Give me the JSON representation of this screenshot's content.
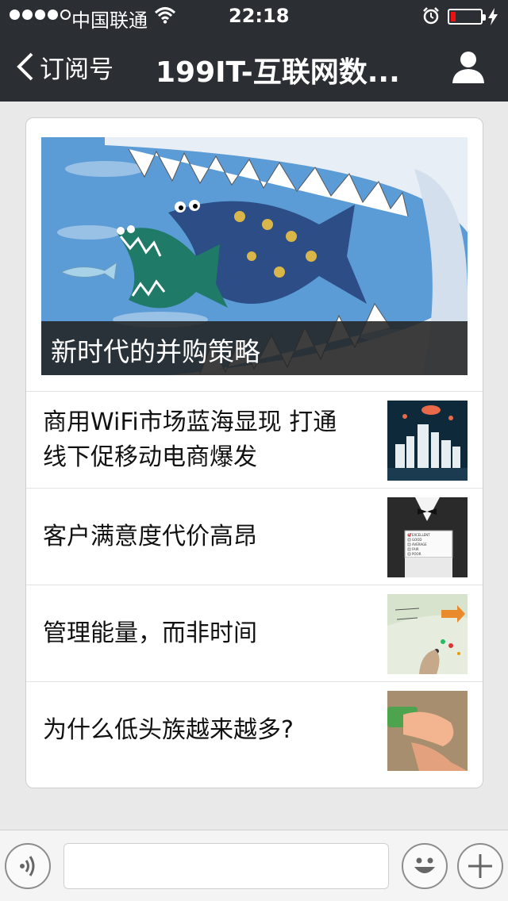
{
  "status_bar": {
    "carrier": "中国联通",
    "time": "22:18",
    "battery_color": "#e11111"
  },
  "nav": {
    "back_label": "订阅号",
    "title": "199IT-互联网数..."
  },
  "hero": {
    "caption": "新时代的并购策略"
  },
  "articles": [
    {
      "title": "商用WiFi市场蓝海显现 打通线下促移动电商爆发"
    },
    {
      "title": "客户满意度代价高昂",
      "thumb_text": [
        "EXCELLENT",
        "GOOD",
        "AVERAGE",
        "FAIR",
        "POOR"
      ]
    },
    {
      "title": "管理能量，而非时间"
    },
    {
      "title": "为什么低头族越来越多?"
    }
  ],
  "bottom_bar": {
    "voice_icon": "voice-icon",
    "emoji_icon": "emoji-icon",
    "plus_icon": "plus-icon"
  }
}
